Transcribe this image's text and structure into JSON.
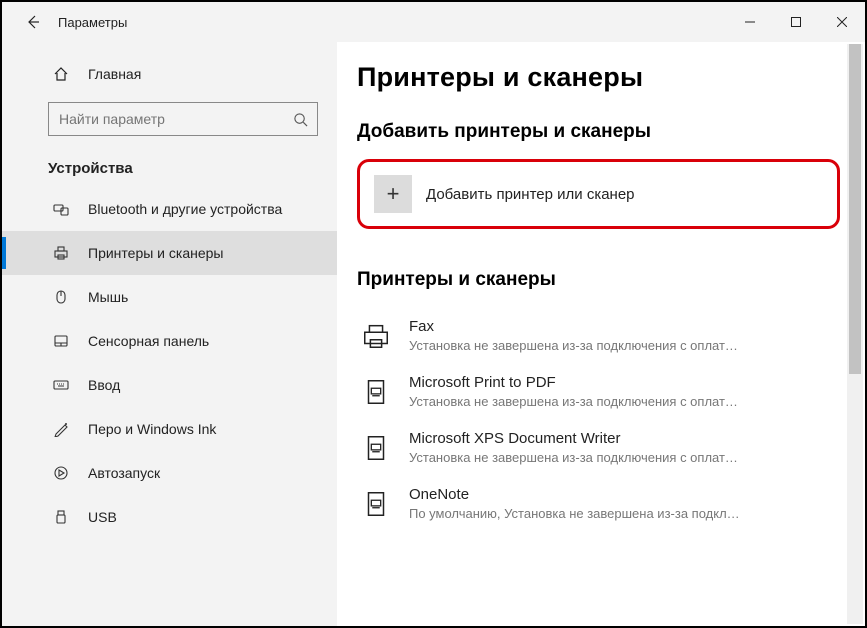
{
  "titlebar": {
    "title": "Параметры"
  },
  "sidebar": {
    "home_label": "Главная",
    "search_placeholder": "Найти параметр",
    "section": "Устройства",
    "items": [
      {
        "label": "Bluetooth и другие устройства"
      },
      {
        "label": "Принтеры и сканеры"
      },
      {
        "label": "Мышь"
      },
      {
        "label": "Сенсорная панель"
      },
      {
        "label": "Ввод"
      },
      {
        "label": "Перо и Windows Ink"
      },
      {
        "label": "Автозапуск"
      },
      {
        "label": "USB"
      }
    ]
  },
  "main": {
    "heading": "Принтеры и сканеры",
    "add_section": "Добавить принтеры и сканеры",
    "add_label": "Добавить принтер или сканер",
    "list_section": "Принтеры и сканеры",
    "printers": [
      {
        "name": "Fax",
        "sub": "Установка не завершена из-за подключения с оплат…"
      },
      {
        "name": "Microsoft Print to PDF",
        "sub": "Установка не завершена из-за подключения с оплат…"
      },
      {
        "name": "Microsoft XPS Document Writer",
        "sub": "Установка не завершена из-за подключения с оплат…"
      },
      {
        "name": "OneNote",
        "sub": "По умолчанию, Установка не завершена из-за подкл…"
      }
    ]
  }
}
